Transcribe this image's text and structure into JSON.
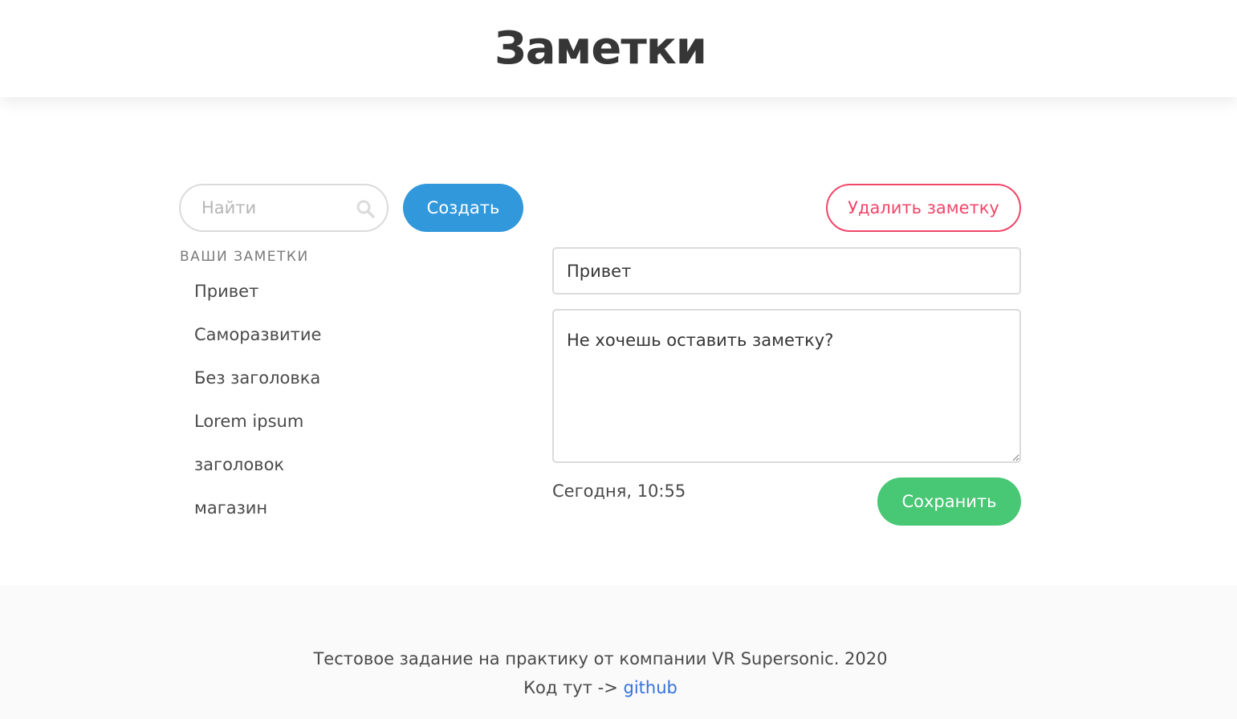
{
  "header": {
    "title": "Заметки"
  },
  "search": {
    "placeholder": "Найти",
    "value": ""
  },
  "toolbar": {
    "create_label": "Создать",
    "delete_label": "Удалить заметку",
    "save_label": "Сохранить"
  },
  "sidebar": {
    "section_label": "ВАШИ ЗАМЕТКИ",
    "items": [
      {
        "label": "Привет"
      },
      {
        "label": "Саморазвитие"
      },
      {
        "label": "Без заголовка"
      },
      {
        "label": "Lorem ipsum"
      },
      {
        "label": "заголовок"
      },
      {
        "label": "магазин"
      }
    ]
  },
  "editor": {
    "title_value": "Привет",
    "body_value": "Не хочешь оставить заметку?",
    "timestamp": "Сегодня, 10:55"
  },
  "footer": {
    "line1": "Тестовое задание на практику от компании VR Supersonic. 2020",
    "line2_prefix": "Код тут -> ",
    "link_label": "github"
  },
  "colors": {
    "primary": "#3298dc",
    "danger": "#f14668",
    "success": "#48c774",
    "link": "#3273dc"
  },
  "icons": {
    "search": "search-icon"
  }
}
